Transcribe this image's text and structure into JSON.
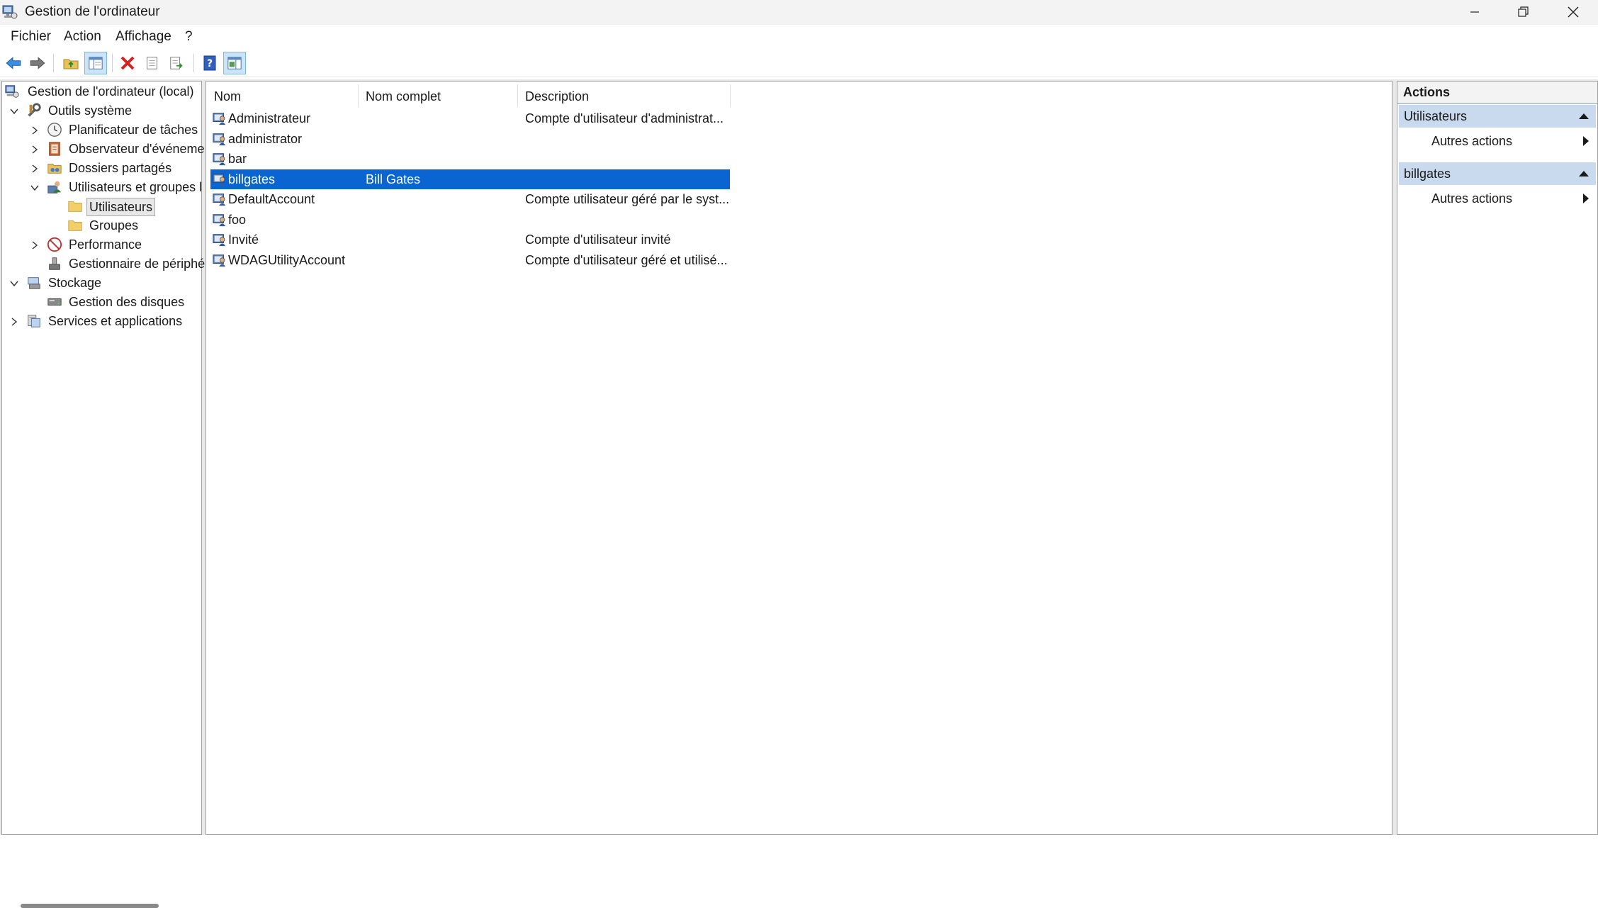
{
  "window": {
    "title": "Gestion de l'ordinateur"
  },
  "menu": [
    "Fichier",
    "Action",
    "Affichage",
    "?"
  ],
  "toolbar": {
    "buttons": [
      "back-icon",
      "forward-icon",
      "up-folder-icon",
      "show-hide-tree-icon",
      "delete-icon",
      "properties-icon",
      "export-list-icon",
      "help-icon",
      "show-hide-action-pane-icon"
    ]
  },
  "tree": {
    "root": "Gestion de l'ordinateur (local)",
    "system_tools": "Outils système",
    "task_scheduler": "Planificateur de tâches",
    "event_viewer": "Observateur d'événeme",
    "shared_folders": "Dossiers partagés",
    "local_users": "Utilisateurs et groupes l",
    "users": "Utilisateurs",
    "groups": "Groupes",
    "performance": "Performance",
    "device_manager": "Gestionnaire de périphé",
    "storage": "Stockage",
    "disk_management": "Gestion des disques",
    "services": "Services et applications"
  },
  "list": {
    "columns": [
      "Nom",
      "Nom complet",
      "Description"
    ],
    "rows": [
      {
        "name": "Administrateur",
        "fullname": "",
        "description": "Compte d'utilisateur d'administrat..."
      },
      {
        "name": "administrator",
        "fullname": "",
        "description": ""
      },
      {
        "name": "bar",
        "fullname": "",
        "description": ""
      },
      {
        "name": "billgates",
        "fullname": "Bill Gates",
        "description": ""
      },
      {
        "name": "DefaultAccount",
        "fullname": "",
        "description": "Compte utilisateur géré par le syst..."
      },
      {
        "name": "foo",
        "fullname": "",
        "description": ""
      },
      {
        "name": "Invité",
        "fullname": "",
        "description": "Compte d'utilisateur invité"
      },
      {
        "name": "WDAGUtilityAccount",
        "fullname": "",
        "description": "Compte d'utilisateur géré et utilisé..."
      }
    ],
    "selected_index": 3
  },
  "actions": {
    "title": "Actions",
    "section1": "Utilisateurs",
    "section1_item": "Autres actions",
    "section2": "billgates",
    "section2_item": "Autres actions"
  },
  "colors": {
    "selection": "#0a64d2",
    "action_section": "#c9d9ee"
  }
}
